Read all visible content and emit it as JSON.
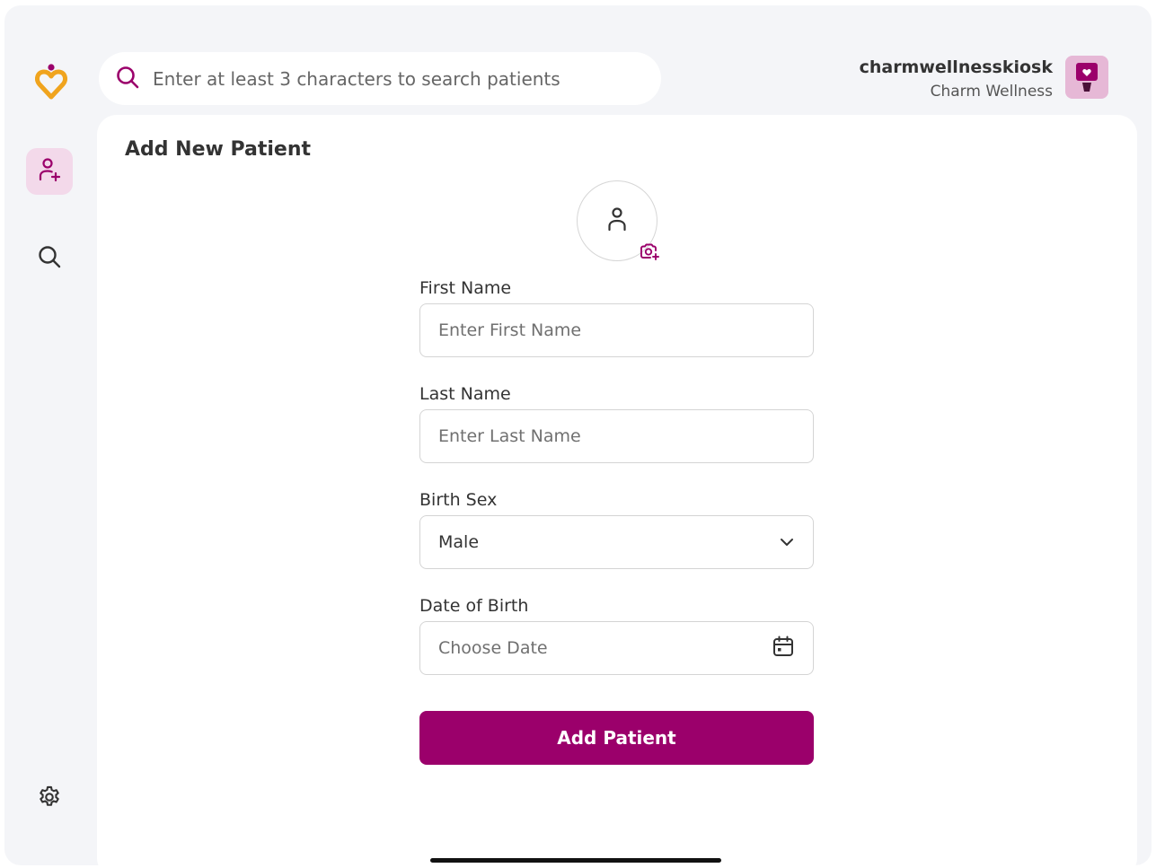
{
  "search": {
    "placeholder": "Enter at least 3 characters to search patients"
  },
  "user": {
    "name": "charmwellnesskiosk",
    "org": "Charm Wellness"
  },
  "page": {
    "title": "Add New Patient"
  },
  "form": {
    "first_name": {
      "label": "First Name",
      "placeholder": "Enter First Name"
    },
    "last_name": {
      "label": "Last Name",
      "placeholder": "Enter Last Name"
    },
    "birth_sex": {
      "label": "Birth Sex",
      "value": "Male"
    },
    "dob": {
      "label": "Date of Birth",
      "placeholder": "Choose Date"
    },
    "submit_label": "Add Patient"
  },
  "colors": {
    "brand": "#9b006b",
    "brand_light": "#f3d9ea",
    "logo_orange": "#f0a41e",
    "background": "#f4f5f8"
  },
  "icons": {
    "logo": "charm-heart-logo",
    "rail": [
      "add-patient-icon",
      "search-icon",
      "gear-icon"
    ],
    "search_bar": "search-icon",
    "photo": "person-icon",
    "photo_add": "camera-add-icon",
    "birth_sex": "chevron-down-icon",
    "dob": "calendar-icon"
  }
}
